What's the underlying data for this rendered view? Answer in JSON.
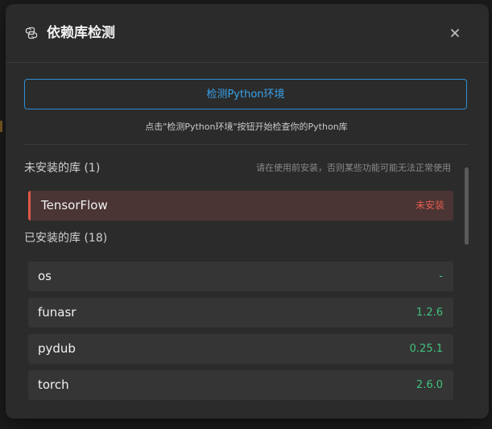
{
  "dialog": {
    "title": "依赖库检测",
    "icon": "python-icon",
    "close_icon": "close-icon"
  },
  "actions": {
    "detect_label": "检测Python环境",
    "hint": "点击\"检测Python环境\"按钮开始检查你的Python库"
  },
  "missing": {
    "title": "未安装的库 (1)",
    "note": "请在使用前安装，否则某些功能可能无法正常使用",
    "items": [
      {
        "name": "TensorFlow",
        "status": "未安装"
      }
    ]
  },
  "installed": {
    "title": "已安装的库 (18)",
    "items": [
      {
        "name": "os",
        "version": "-"
      },
      {
        "name": "funasr",
        "version": "1.2.6"
      },
      {
        "name": "pydub",
        "version": "0.25.1"
      },
      {
        "name": "torch",
        "version": "2.6.0"
      }
    ]
  },
  "colors": {
    "accent": "#37a3ec",
    "installed_version": "#3fc27e",
    "missing_status": "#e35d4f"
  }
}
